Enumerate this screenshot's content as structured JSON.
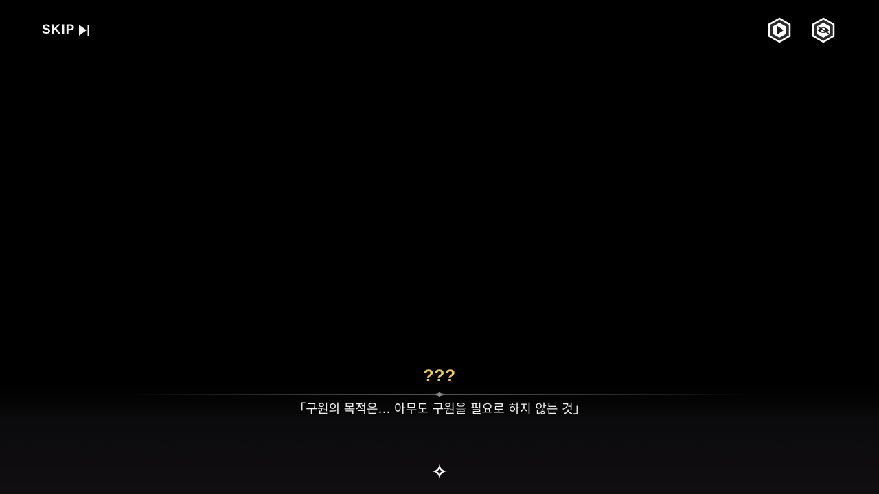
{
  "controls": {
    "skip_label": "SKIP",
    "skip_icon": "skip-forward-icon",
    "auto_play_icon": "auto-play-icon",
    "hide_ui_icon": "hide-ui-eye-icon"
  },
  "dialogue": {
    "speaker": "???",
    "text": "「구원의 목적은… 아무도 구원을 필요로 하지 않는 것」",
    "next_icon": "sparkle-next-icon"
  },
  "colors": {
    "background": "#000000",
    "speaker_name": "#f3c759",
    "dialogue_text": "#f0f0f0",
    "ui_white": "#f2f2f2"
  }
}
